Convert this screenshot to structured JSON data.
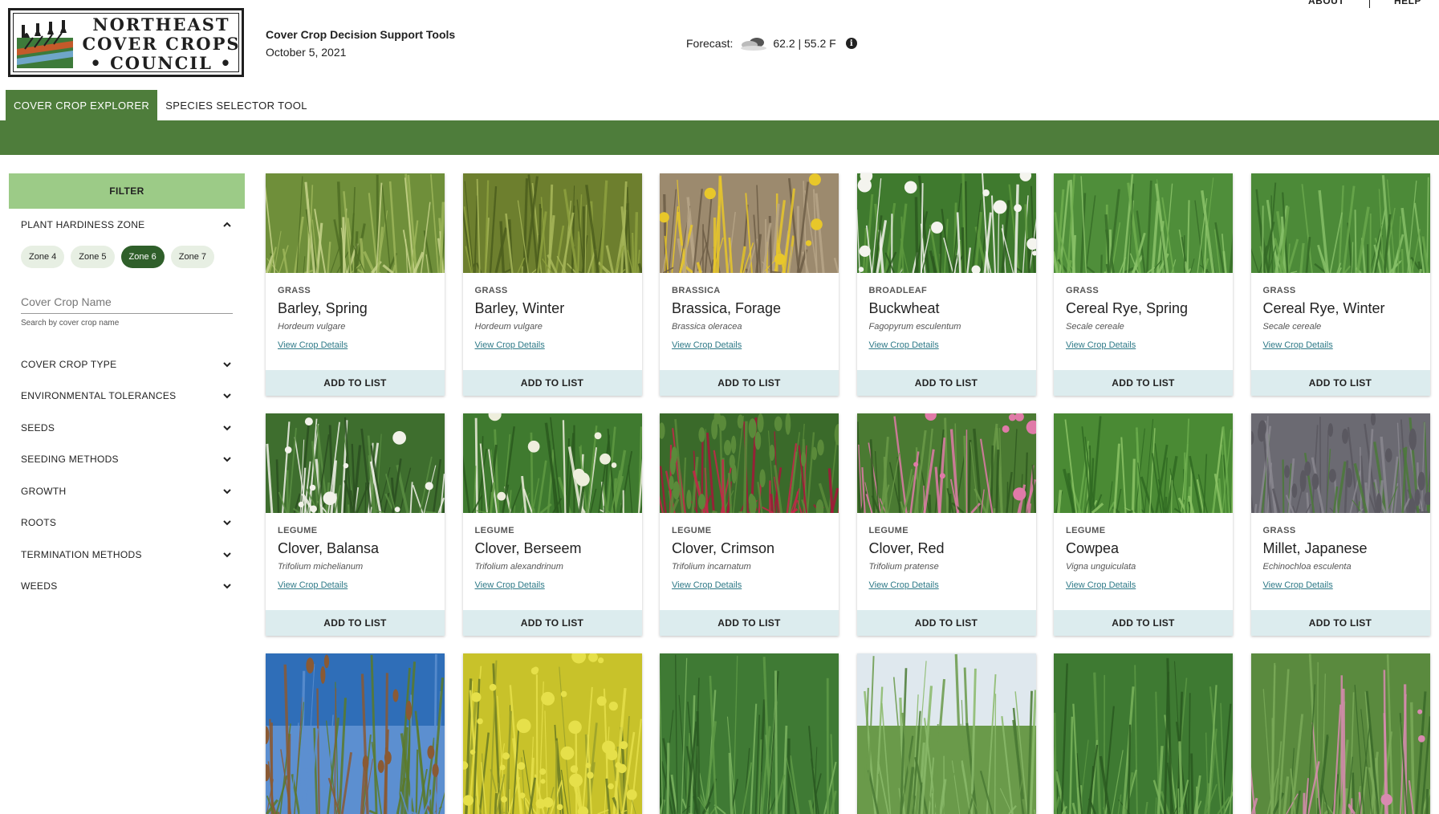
{
  "logo": {
    "line1": "NORTHEAST",
    "line2": "COVER CROPS",
    "line3": "• COUNCIL •"
  },
  "header": {
    "title": "Cover Crop Decision Support Tools",
    "date": "October 5, 2021"
  },
  "forecast": {
    "label": "Forecast:",
    "value": "62.2 | 55.2 F",
    "icon": "cloud-icon"
  },
  "topnav": {
    "about": "ABOUT",
    "help": "HELP"
  },
  "tabs": [
    {
      "label": "COVER CROP EXPLORER",
      "active": true
    },
    {
      "label": "SPECIES SELECTOR TOOL",
      "active": false
    }
  ],
  "sidebar": {
    "filter_label": "FILTER",
    "hardiness": {
      "label": "PLANT HARDINESS ZONE",
      "zones": [
        "Zone 4",
        "Zone 5",
        "Zone 6",
        "Zone 7"
      ],
      "selected": "Zone 6"
    },
    "search": {
      "placeholder": "Cover Crop Name",
      "help": "Search by cover crop name"
    },
    "filters": [
      "COVER CROP TYPE",
      "ENVIRONMENTAL TOLERANCES",
      "SEEDS",
      "SEEDING METHODS",
      "GROWTH",
      "ROOTS",
      "TERMINATION METHODS",
      "WEEDS"
    ]
  },
  "cards": [
    {
      "type": "GRASS",
      "name": "Barley, Spring",
      "sci": "Hordeum vulgare",
      "link": "View Crop Details",
      "button": "ADD TO LIST",
      "img": "barley-spring"
    },
    {
      "type": "GRASS",
      "name": "Barley, Winter",
      "sci": "Hordeum vulgare",
      "link": "View Crop Details",
      "button": "ADD TO LIST",
      "img": "barley-winter"
    },
    {
      "type": "BRASSICA",
      "name": "Brassica, Forage",
      "sci": "Brassica oleracea",
      "link": "View Crop Details",
      "button": "ADD TO LIST",
      "img": "brassica"
    },
    {
      "type": "BROADLEAF",
      "name": "Buckwheat",
      "sci": "Fagopyrum esculentum",
      "link": "View Crop Details",
      "button": "ADD TO LIST",
      "img": "buckwheat"
    },
    {
      "type": "GRASS",
      "name": "Cereal Rye, Spring",
      "sci": "Secale cereale",
      "link": "View Crop Details",
      "button": "ADD TO LIST",
      "img": "rye-spring"
    },
    {
      "type": "GRASS",
      "name": "Cereal Rye, Winter",
      "sci": "Secale cereale",
      "link": "View Crop Details",
      "button": "ADD TO LIST",
      "img": "rye-winter"
    },
    {
      "type": "LEGUME",
      "name": "Clover, Balansa",
      "sci": "Trifolium michelianum",
      "link": "View Crop Details",
      "button": "ADD TO LIST",
      "img": "clover-balansa"
    },
    {
      "type": "LEGUME",
      "name": "Clover, Berseem",
      "sci": "Trifolium alexandrinum",
      "link": "View Crop Details",
      "button": "ADD TO LIST",
      "img": "clover-berseem"
    },
    {
      "type": "LEGUME",
      "name": "Clover, Crimson",
      "sci": "Trifolium incarnatum",
      "link": "View Crop Details",
      "button": "ADD TO LIST",
      "img": "clover-crimson"
    },
    {
      "type": "LEGUME",
      "name": "Clover, Red",
      "sci": "Trifolium pratense",
      "link": "View Crop Details",
      "button": "ADD TO LIST",
      "img": "clover-red"
    },
    {
      "type": "LEGUME",
      "name": "Cowpea",
      "sci": "Vigna unguiculata",
      "link": "View Crop Details",
      "button": "ADD TO LIST",
      "img": "cowpea"
    },
    {
      "type": "GRASS",
      "name": "Millet, Japanese",
      "sci": "Echinochloa esculenta",
      "link": "View Crop Details",
      "button": "ADD TO LIST",
      "img": "millet"
    }
  ],
  "partial_cards": [
    "millet-pearl",
    "mustard",
    "oats",
    "field",
    "oats-2",
    "peas"
  ],
  "colors": {
    "accent": "#4e7d3b",
    "filter_bg": "#9ccb87",
    "button_bg": "#dcecee",
    "link": "#2f7a88"
  }
}
